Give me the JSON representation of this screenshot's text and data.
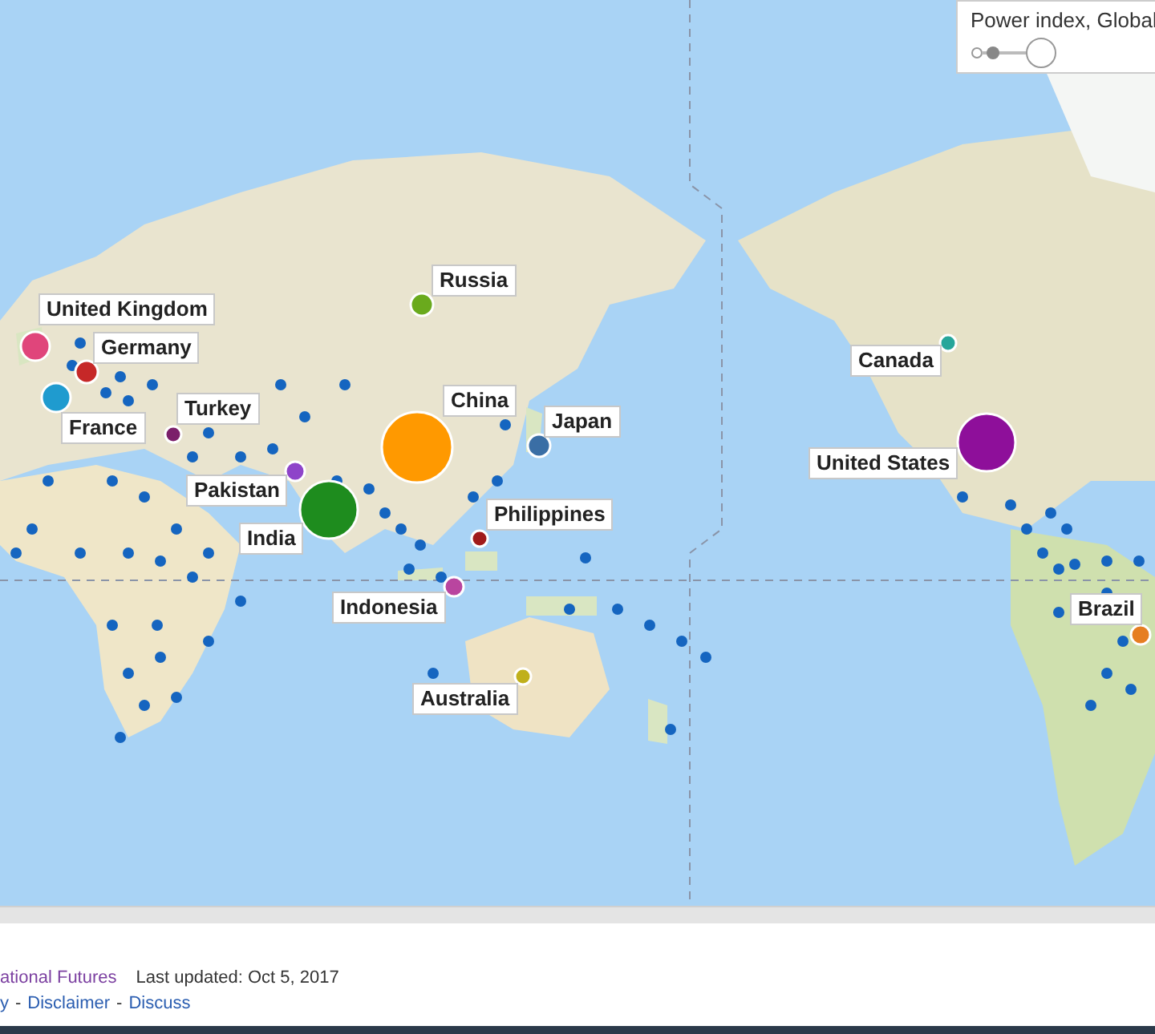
{
  "legend": {
    "title": "Power index, Global"
  },
  "countries": [
    {
      "name": "Russia",
      "color": "#6aaa1d"
    },
    {
      "name": "United Kingdom",
      "color": "#e0457b"
    },
    {
      "name": "Germany",
      "color": "#c62828"
    },
    {
      "name": "Canada",
      "color": "#26a69a"
    },
    {
      "name": "Turkey",
      "color": "#7b1f6a"
    },
    {
      "name": "China",
      "color": "#ff9900"
    },
    {
      "name": "France",
      "color": "#1f9bcf"
    },
    {
      "name": "Japan",
      "color": "#3a6ea5"
    },
    {
      "name": "United States",
      "color": "#8e0f9a"
    },
    {
      "name": "Pakistan",
      "color": "#8e44c9"
    },
    {
      "name": "Philippines",
      "color": "#a01b1b"
    },
    {
      "name": "India",
      "color": "#1e8c1e"
    },
    {
      "name": "Indonesia",
      "color": "#b9459f"
    },
    {
      "name": "Brazil",
      "color": "#e67e22"
    },
    {
      "name": "Australia",
      "color": "#c0b01c"
    }
  ],
  "footer": {
    "source_link": "ational Futures",
    "last_updated": "Last updated: Oct 5, 2017",
    "links": [
      "y",
      "Disclaimer",
      "Discuss"
    ],
    "separator": "-"
  }
}
